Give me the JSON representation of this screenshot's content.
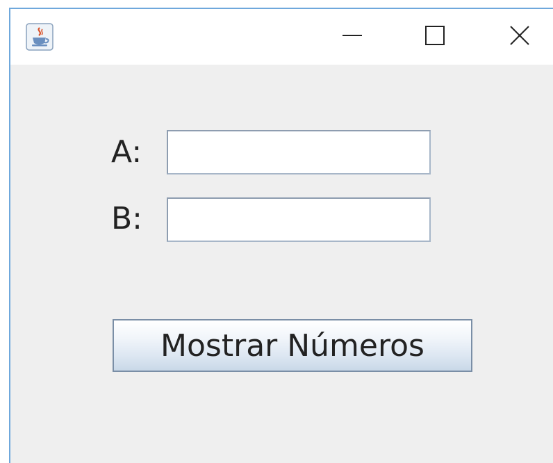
{
  "window": {
    "app_icon": "java-coffee-icon",
    "controls": {
      "minimize": "minimize-icon",
      "maximize": "maximize-icon",
      "close": "close-icon"
    }
  },
  "form": {
    "label_a": "A:",
    "label_b": "B:",
    "value_a": "",
    "value_b": "",
    "button_label": "Mostrar Números"
  },
  "colors": {
    "window_border": "#6fa8dc",
    "content_background": "#efefef",
    "button_border": "#7a8ea6"
  }
}
